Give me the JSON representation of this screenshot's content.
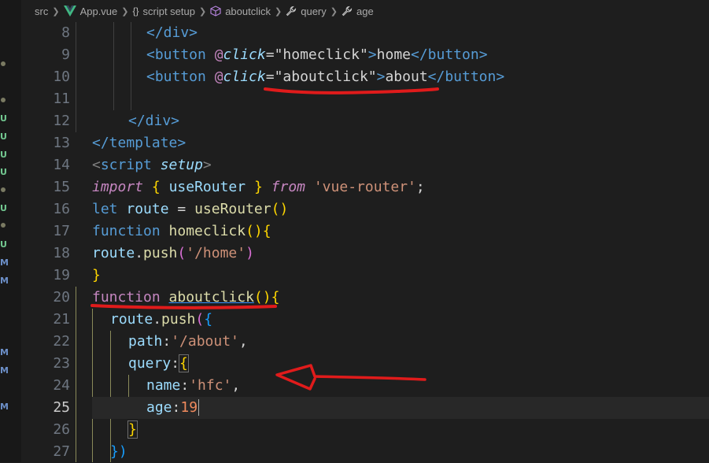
{
  "breadcrumb": {
    "items": [
      "src",
      "App.vue",
      "script setup",
      "aboutclick",
      "query",
      "age"
    ],
    "icons": [
      "vue-icon",
      "braces-icon",
      "cube-icon",
      "wrench-icon",
      "wrench-icon"
    ]
  },
  "gutter_marks": [
    "U",
    "U",
    "U",
    "U",
    "U",
    "U",
    "M",
    "M",
    "M",
    "M",
    "M"
  ],
  "colors": {
    "annotation": "#e01b1b",
    "background": "#1e1e1e"
  },
  "lines": {
    "n8": "8",
    "n9": "9",
    "n10": "10",
    "n11": "11",
    "n12": "12",
    "n13": "13",
    "n14": "14",
    "n15": "15",
    "n16": "16",
    "n17": "17",
    "n18": "18",
    "n19": "19",
    "n20": "20",
    "n21": "21",
    "n22": "22",
    "n23": "23",
    "n24": "24",
    "n25": "25",
    "n26": "26",
    "n27": "27"
  },
  "code": {
    "l8_close_div": "</div>",
    "l9_open": "<button",
    "l9_at": "@",
    "l9_attr": "click",
    "l9_eq": "=",
    "l9_val": "\"homeclick\"",
    "l9_gt": ">",
    "l9_text": "home",
    "l9_close": "</button>",
    "l10_open": "<button",
    "l10_at": "@",
    "l10_attr": "click",
    "l10_eq": "=",
    "l10_val": "\"aboutclick\"",
    "l10_gt": ">",
    "l10_text": "about",
    "l10_close": "</button>",
    "l12_close_div": "</div>",
    "l13_close_template": "</template>",
    "l14_lt": "<",
    "l14_tag": "script",
    "l14_attr": "setup",
    "l14_gt": ">",
    "l15_import": "import",
    "l15_lb": "{",
    "l15_name": "useRouter",
    "l15_rb": "}",
    "l15_from": "from",
    "l15_str": "'vue-router'",
    "l15_semi": ";",
    "l16_let": "let",
    "l16_var": "route",
    "l16_eq": "=",
    "l16_fn": "useRouter",
    "l16_paren": "()",
    "l17_kw": "function",
    "l17_fn": "homeclick",
    "l17_paren": "()",
    "l17_brace": "{",
    "l18_obj": "route",
    "l18_dot": ".",
    "l18_method": "push",
    "l18_lp": "(",
    "l18_str": "'/home'",
    "l18_rp": ")",
    "l19_brace": "}",
    "l20_kw": "function",
    "l20_fn": "aboutclick",
    "l20_paren": "()",
    "l20_brace": "{",
    "l21_obj": "route",
    "l21_dot": ".",
    "l21_method": "push",
    "l21_lp": "(",
    "l21_lb": "{",
    "l22_key": "path",
    "l22_colon": ":",
    "l22_str": "'/about'",
    "l22_comma": ",",
    "l23_key": "query",
    "l23_colon": ":",
    "l23_lb": "{",
    "l24_key": "name",
    "l24_colon": ":",
    "l24_str": "'hfc'",
    "l24_comma": ",",
    "l25_key": "age",
    "l25_colon": ":",
    "l25_num": "19",
    "l26_rb": "}",
    "l27_close": "})"
  }
}
